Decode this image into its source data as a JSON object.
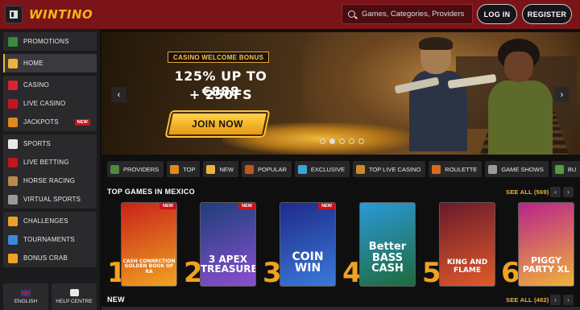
{
  "header": {
    "brand": "WINTINO",
    "search_placeholder": "Games, Categories, Providers",
    "login_label": "LOG IN",
    "register_label": "REGISTER",
    "accent": "#7a1418"
  },
  "sidebar": {
    "groups": [
      [
        {
          "label": "PROMOTIONS",
          "icon": "promotions-icon"
        }
      ],
      [
        {
          "label": "HOME",
          "icon": "home-icon",
          "active": true
        }
      ],
      [
        {
          "label": "CASINO",
          "icon": "cherry-icon"
        },
        {
          "label": "LIVE CASINO",
          "icon": "live-casino-icon"
        },
        {
          "label": "JACKPOTS",
          "icon": "horseshoe-icon",
          "badge": "NEW"
        }
      ],
      [
        {
          "label": "SPORTS",
          "icon": "soccer-ball-icon"
        },
        {
          "label": "LIVE BETTING",
          "icon": "live-betting-icon"
        },
        {
          "label": "HORSE RACING",
          "icon": "horse-icon"
        },
        {
          "label": "VIRTUAL SPORTS",
          "icon": "controller-icon"
        }
      ],
      [
        {
          "label": "CHALLENGES",
          "icon": "challenges-icon"
        },
        {
          "label": "TOURNAMENTS",
          "icon": "trophy-icon"
        },
        {
          "label": "BONUS CRAB",
          "icon": "crab-icon"
        }
      ]
    ],
    "language": "ENGLISH",
    "help": "HELP CENTRE"
  },
  "banner": {
    "tag": "CASINO WELCOME BONUS",
    "line1": "125% UP TO €888",
    "line2": "+ 250FS",
    "cta": "JOIN NOW",
    "active_slide": 1,
    "slide_count": 5
  },
  "categories": [
    {
      "label": "PROVIDERS",
      "icon": "providers-icon",
      "color": "#4e8a3a"
    },
    {
      "label": "TOP",
      "icon": "crown-icon",
      "color": "#e08a1e"
    },
    {
      "label": "NEW",
      "icon": "lightning-icon",
      "color": "#f0b33a"
    },
    {
      "label": "POPULAR",
      "icon": "flame-icon",
      "color": "#c2551f"
    },
    {
      "label": "EXCLUSIVE",
      "icon": "diamond-icon",
      "color": "#3aa6d8"
    },
    {
      "label": "TOP LIVE CASINO",
      "icon": "live-dealer-icon",
      "color": "#c98a2a"
    },
    {
      "label": "ROULETTE",
      "icon": "roulette-icon",
      "color": "#d86a1e"
    },
    {
      "label": "GAME SHOWS",
      "icon": "game-shows-icon",
      "color": "#9a9a9a"
    },
    {
      "label": "BU",
      "icon": "bonus-buy-icon",
      "color": "#5a9a3a"
    }
  ],
  "top_games": {
    "title": "TOP GAMES IN MEXICO",
    "see_all": "SEE ALL (569)",
    "games": [
      {
        "rank": "1",
        "name": "CASH CONNECTION GOLDEN BOOK OF RA",
        "badge": "NEW",
        "bg": "#c8231a",
        "bg2": "#f0a321"
      },
      {
        "rank": "2",
        "name": "3 APEX TREASURES",
        "badge": "NEW",
        "bg": "#1d3f7a",
        "bg2": "#8a4fd0"
      },
      {
        "rank": "3",
        "name": "COIN WIN",
        "badge": "NEW",
        "bg": "#1f2a8a",
        "bg2": "#3a7ad8"
      },
      {
        "rank": "4",
        "name": "Better BASS CASH",
        "badge": "",
        "bg": "#2a9ad8",
        "bg2": "#1f6a3a"
      },
      {
        "rank": "5",
        "name": "KING AND FLAME",
        "badge": "",
        "bg": "#6a1a2a",
        "bg2": "#e05a2a"
      },
      {
        "rank": "6",
        "name": "PIGGY PARTY XL",
        "badge": "",
        "bg": "#b8238a",
        "bg2": "#f0b33a"
      }
    ]
  },
  "new_section": {
    "title": "NEW",
    "see_all": "SEE ALL (482)"
  }
}
